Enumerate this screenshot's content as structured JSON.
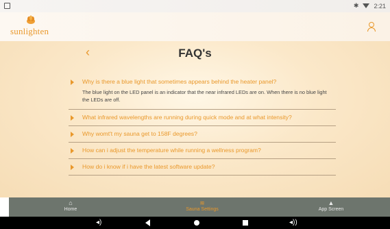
{
  "status_bar": {
    "time": "2:21",
    "bluetooth_icon": "bluetooth-icon",
    "wifi_icon": "wifi-icon"
  },
  "header": {
    "logo_text": "sunlighten",
    "brand_color": "#e9982b"
  },
  "page": {
    "back_glyph": "‹",
    "title": "FAQ's"
  },
  "faqs": [
    {
      "question": "Why is there a blue light that sometimes appears behind the heater panel?",
      "answer": "The blue light on the LED panel is an indicator that the near infrared LEDs are on. When there is no blue light the LEDs are off."
    },
    {
      "question": "What infrared wavelengths are running during quick mode and at what intensity?"
    },
    {
      "question": "Why womt't my sauna get to 158F degrees?"
    },
    {
      "question": "How can i adjust the temperature while running a wellness program?"
    },
    {
      "question": "How do i know if i have the latest software update?"
    }
  ],
  "nav": {
    "home": "Home",
    "sauna_settings": "Sauna Settings",
    "app_screen": "App Screen"
  },
  "colors": {
    "accent": "#e9982b",
    "nav_bg": "#6d756d",
    "divider": "#b59f83"
  }
}
